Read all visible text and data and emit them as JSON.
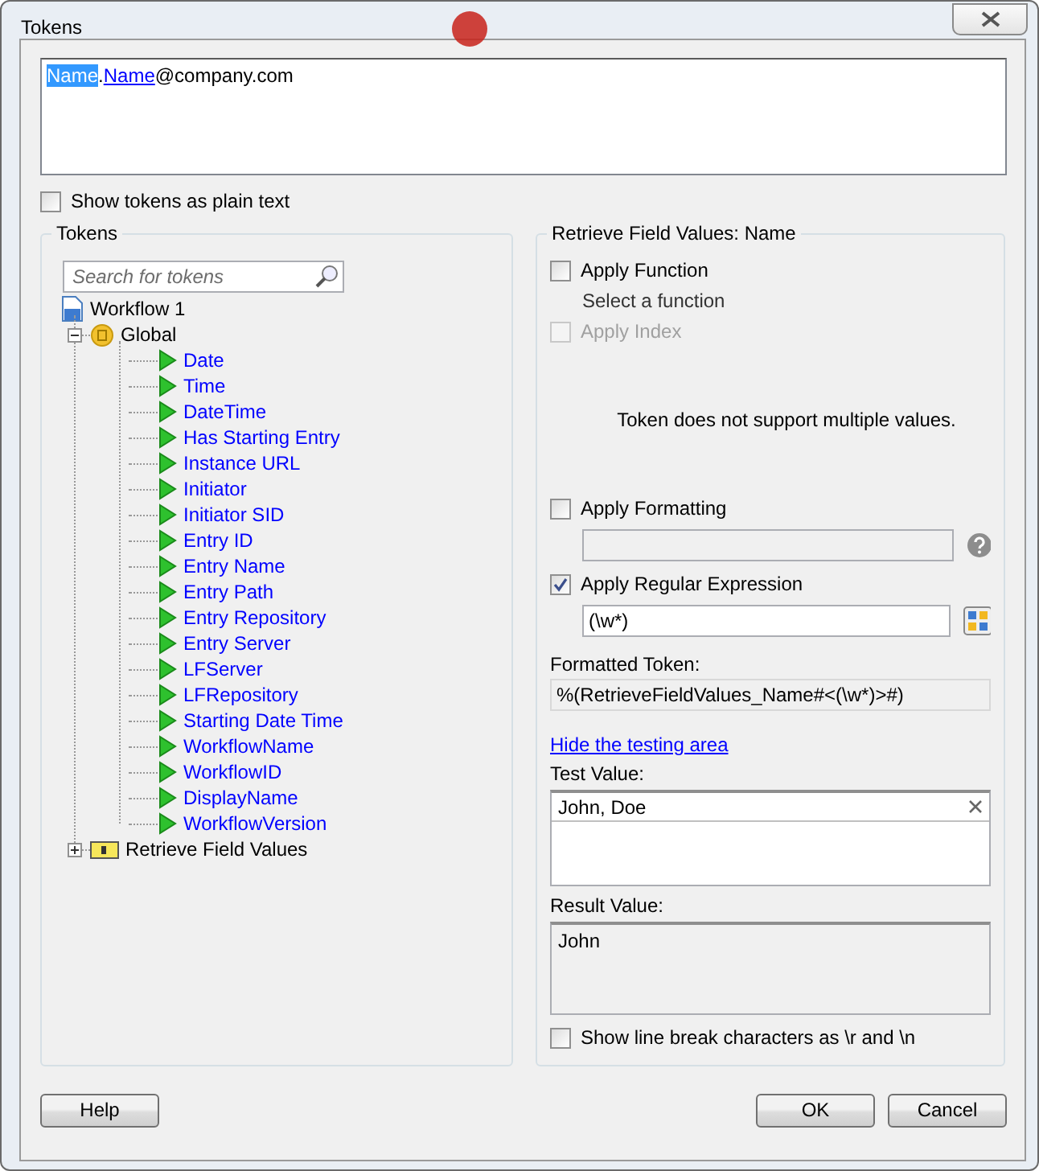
{
  "window": {
    "title": "Tokens"
  },
  "token_editor": {
    "segments": [
      {
        "text": "Name",
        "kind": "selected-token"
      },
      {
        "text": ".",
        "kind": "text"
      },
      {
        "text": "Name",
        "kind": "token"
      },
      {
        "text": "@company.com",
        "kind": "text"
      }
    ]
  },
  "plain_text_option": {
    "label": "Show tokens as plain text",
    "checked": false
  },
  "tokens_panel": {
    "title": "Tokens",
    "search": {
      "placeholder": "Search for tokens"
    },
    "tree": [
      {
        "label": "Workflow 1",
        "kind": "workflow",
        "children": [
          {
            "label": "Global",
            "kind": "group",
            "expanded": true,
            "children": [
              {
                "label": "Date",
                "kind": "token"
              },
              {
                "label": "Time",
                "kind": "token"
              },
              {
                "label": "DateTime",
                "kind": "token"
              },
              {
                "label": "Has Starting Entry",
                "kind": "token"
              },
              {
                "label": "Instance URL",
                "kind": "token"
              },
              {
                "label": "Initiator",
                "kind": "token"
              },
              {
                "label": "Initiator SID",
                "kind": "token"
              },
              {
                "label": "Entry ID",
                "kind": "token"
              },
              {
                "label": "Entry Name",
                "kind": "token"
              },
              {
                "label": "Entry Path",
                "kind": "token"
              },
              {
                "label": "Entry Repository",
                "kind": "token"
              },
              {
                "label": "Entry Server",
                "kind": "token"
              },
              {
                "label": "LFServer",
                "kind": "token"
              },
              {
                "label": "LFRepository",
                "kind": "token"
              },
              {
                "label": "Starting Date Time",
                "kind": "token"
              },
              {
                "label": "WorkflowName",
                "kind": "token"
              },
              {
                "label": "WorkflowID",
                "kind": "token"
              },
              {
                "label": "DisplayName",
                "kind": "token"
              },
              {
                "label": "WorkflowVersion",
                "kind": "token"
              }
            ]
          },
          {
            "label": "Retrieve Field Values",
            "kind": "field-group",
            "expanded": false
          }
        ]
      }
    ]
  },
  "options_panel": {
    "title": "Retrieve Field Values: Name",
    "apply_function": {
      "label": "Apply Function",
      "checked": false,
      "disabled": false,
      "hint": "Select a function"
    },
    "apply_index": {
      "label": "Apply Index",
      "checked": false,
      "disabled": true
    },
    "message": "Token does not support multiple values.",
    "apply_formatting": {
      "label": "Apply Formatting",
      "checked": false,
      "disabled": false
    },
    "apply_regex": {
      "label": "Apply Regular Expression",
      "checked": true,
      "disabled": false,
      "value": "(\\w*)"
    },
    "formatted_token_label": "Formatted Token:",
    "formatted_token": "%(RetrieveFieldValues_Name#<(\\w*)>#)",
    "testing_link": "Hide the testing area",
    "test_value_label": "Test Value:",
    "test_value": "John, Doe",
    "result_value_label": "Result Value:",
    "result_value": "John",
    "line_break_option": {
      "label": "Show line break characters as \\r and \\n",
      "checked": false
    }
  },
  "buttons": {
    "help": "Help",
    "ok": "OK",
    "cancel": "Cancel"
  }
}
